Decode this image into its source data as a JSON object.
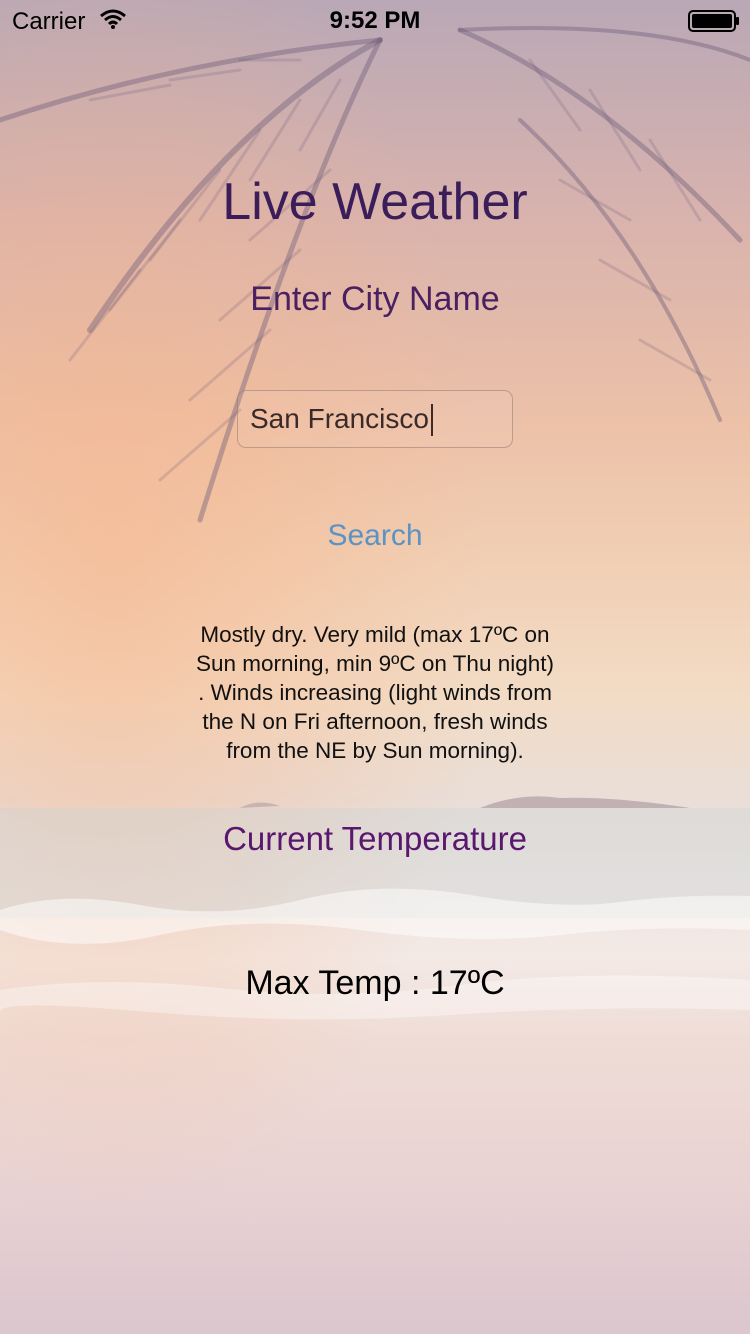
{
  "status_bar": {
    "carrier": "Carrier",
    "time": "9:52 PM",
    "icons": [
      "wifi-icon",
      "battery-icon"
    ]
  },
  "app": {
    "title": "Live Weather",
    "prompt": "Enter City Name",
    "search": {
      "value": "San Francisco",
      "placeholder": ""
    },
    "search_button": "Search",
    "forecast_lines": [
      "Mostly dry. Very mild (max 17ºC on",
      "Sun morning, min 9ºC on Thu night)",
      ". Winds increasing (light winds from",
      "the N on Fri afternoon, fresh winds",
      "from the NE by Sun morning)."
    ],
    "current_temperature_label": "Current Temperature",
    "max_temp": "Max Temp : 17ºC"
  },
  "colors": {
    "title": "#3b1d5a",
    "prompt": "#4a2060",
    "search_button": "#5b93c4",
    "section_heading": "#5a176e"
  }
}
